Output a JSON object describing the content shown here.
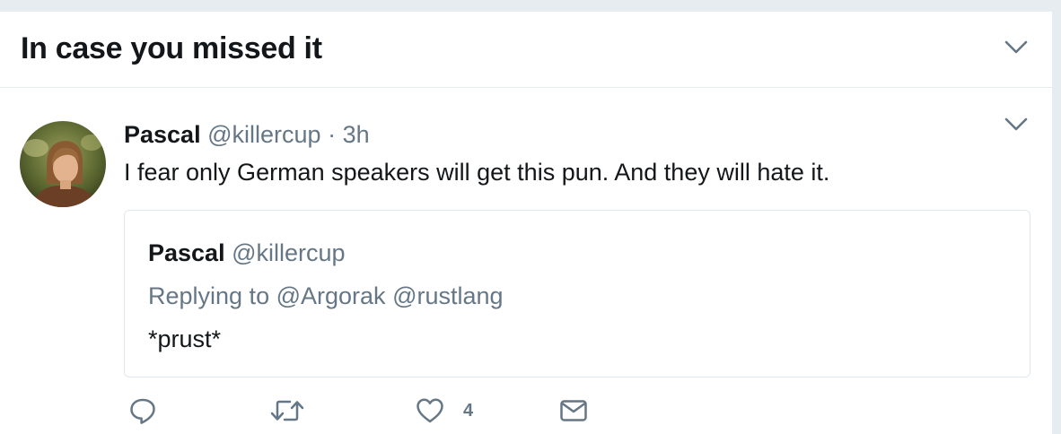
{
  "module": {
    "title": "In case you missed it"
  },
  "tweet": {
    "fullname": "Pascal",
    "screen_name": "@killercup",
    "separator": "·",
    "time": "3h",
    "text": "I fear only German speakers will get this pun. And they will hate it.",
    "quoted": {
      "fullname": "Pascal",
      "screen_name": "@killercup",
      "replying_to_label": "Replying to",
      "replying_to": [
        "@Argorak",
        "@rustlang"
      ],
      "text": "*prust*"
    },
    "actions": {
      "reply_icon": "reply-icon",
      "retweet_icon": "retweet-icon",
      "like_icon": "heart-icon",
      "like_count": "4",
      "dm_icon": "envelope-icon"
    }
  },
  "colors": {
    "primary_text": "#14171a",
    "secondary_text": "#657786",
    "border": "#e1e8ed",
    "page_background": "#e6ecf0"
  }
}
